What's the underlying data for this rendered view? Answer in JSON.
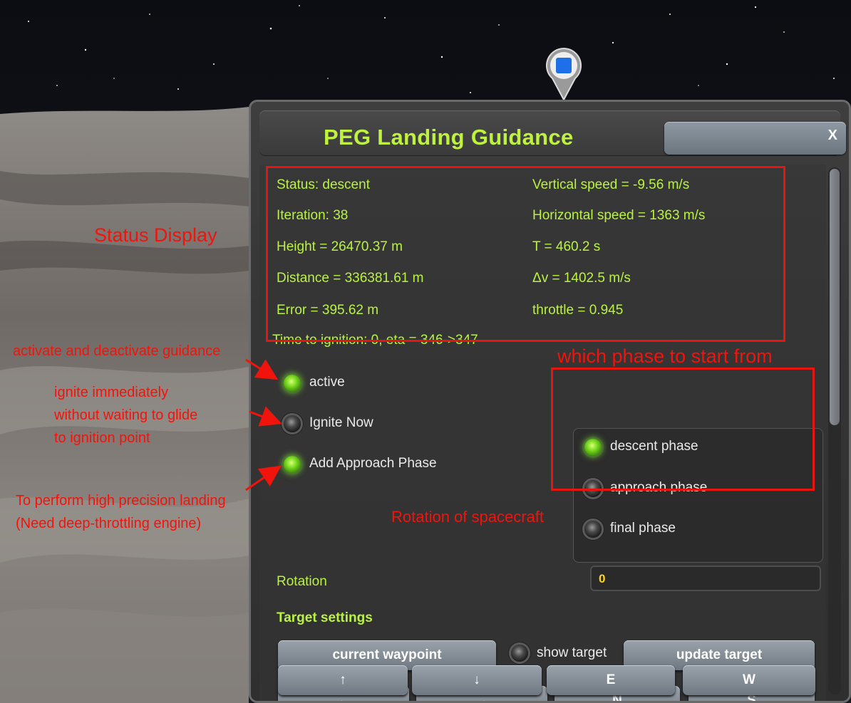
{
  "window": {
    "title": "PEG Landing Guidance",
    "close_label": "X"
  },
  "status": {
    "left": [
      "Status: descent",
      "Iteration: 38",
      "Height = 26470.37 m",
      "Distance = 336381.61 m",
      "Error = 395.62 m"
    ],
    "right": [
      "Vertical speed = -9.56 m/s",
      "Horizontal speed = 1363 m/s",
      "T = 460.2 s",
      "Δv = 1402.5 m/s",
      "throttle = 0.945"
    ],
    "ignition_line": "Time to ignition: 0, eta = 346->347"
  },
  "toggles": {
    "active": {
      "label": "active",
      "on": true
    },
    "ignite_now": {
      "label": "Ignite Now",
      "on": false
    },
    "add_approach": {
      "label": "Add Approach Phase",
      "on": true
    }
  },
  "phases": [
    {
      "label": "descent phase",
      "on": true
    },
    {
      "label": "approach phase",
      "on": false
    },
    {
      "label": "final phase",
      "on": false
    }
  ],
  "rotation": {
    "label": "Rotation",
    "value": "0"
  },
  "target": {
    "heading": "Target settings",
    "current_waypoint": "current waypoint",
    "show_target": "show target",
    "update_target": "update target",
    "row1": [
      "←",
      "→",
      "N",
      "S"
    ],
    "row2": [
      "↑",
      "↓",
      "E",
      "W"
    ]
  },
  "annotations": {
    "status_display": "Status Display",
    "activate": "activate and deactivate guidance",
    "ignite": [
      "ignite immediately",
      "without waiting to glide",
      "to ignition point"
    ],
    "precision": [
      "To perform high precision landing",
      "(Need deep-throttling engine)"
    ],
    "rotation": "Rotation of spacecraft",
    "phase": "which phase to start from"
  },
  "colors": {
    "status_text": "#b9f240",
    "title_text": "#bff23e",
    "annotation_red": "#f0140c",
    "rotation_value": "#ffd21e"
  }
}
